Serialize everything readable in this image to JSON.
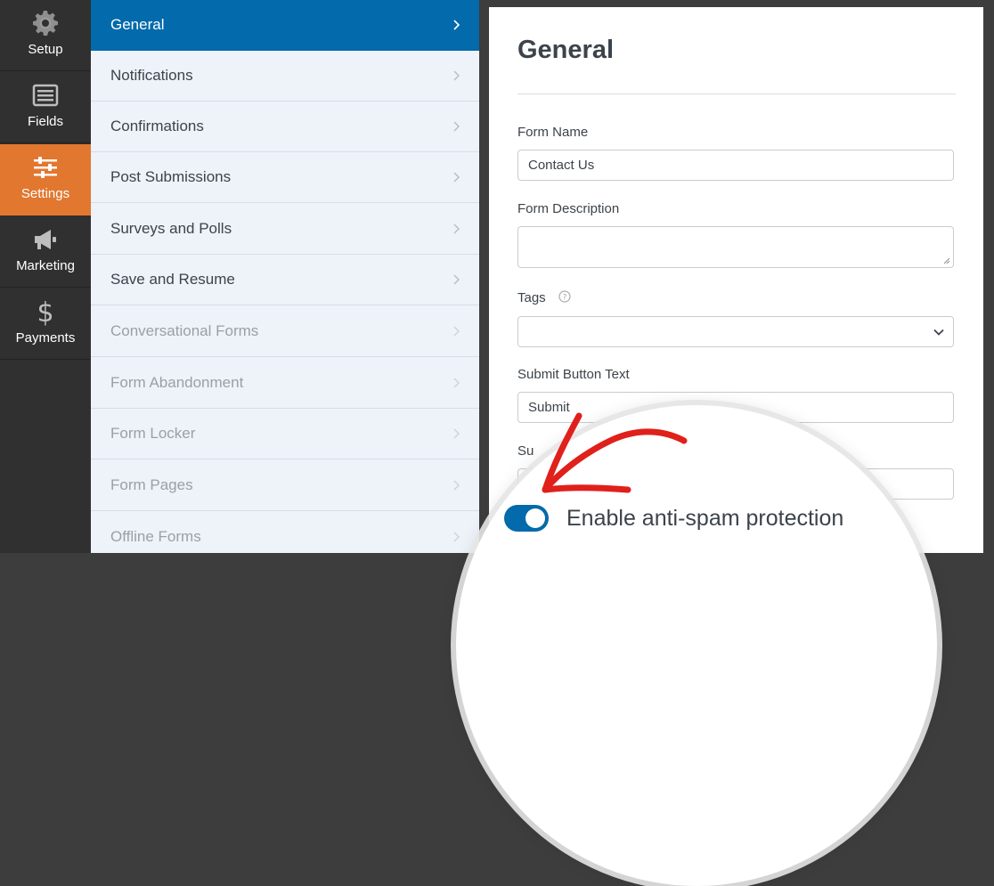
{
  "rail": {
    "items": [
      {
        "label": "Setup",
        "icon": "gear-icon"
      },
      {
        "label": "Fields",
        "icon": "fields-icon"
      },
      {
        "label": "Settings",
        "icon": "sliders-icon"
      },
      {
        "label": "Marketing",
        "icon": "megaphone-icon"
      },
      {
        "label": "Payments",
        "icon": "dollar-icon"
      }
    ],
    "active_index": 2,
    "active_color": "#e27730"
  },
  "submenu": {
    "items": [
      {
        "label": "General"
      },
      {
        "label": "Notifications"
      },
      {
        "label": "Confirmations"
      },
      {
        "label": "Post Submissions"
      },
      {
        "label": "Surveys and Polls"
      },
      {
        "label": "Save and Resume"
      },
      {
        "label": "Conversational Forms"
      },
      {
        "label": "Form Abandonment"
      },
      {
        "label": "Form Locker"
      },
      {
        "label": "Form Pages"
      },
      {
        "label": "Offline Forms"
      }
    ],
    "active_index": 0,
    "active_color": "#036aab"
  },
  "panel": {
    "title": "General",
    "form_name_label": "Form Name",
    "form_name_value": "Contact Us",
    "form_description_label": "Form Description",
    "form_description_value": "",
    "tags_label": "Tags",
    "tags_value": "",
    "submit_text_label": "Submit Button Text",
    "submit_text_value": "Submit",
    "partial_label": "Su"
  },
  "magnifier": {
    "toggle_label": "Enable anti-spam protection",
    "toggle_on": true,
    "toggle_color": "#036aab",
    "arrow_color": "#e0201b"
  }
}
